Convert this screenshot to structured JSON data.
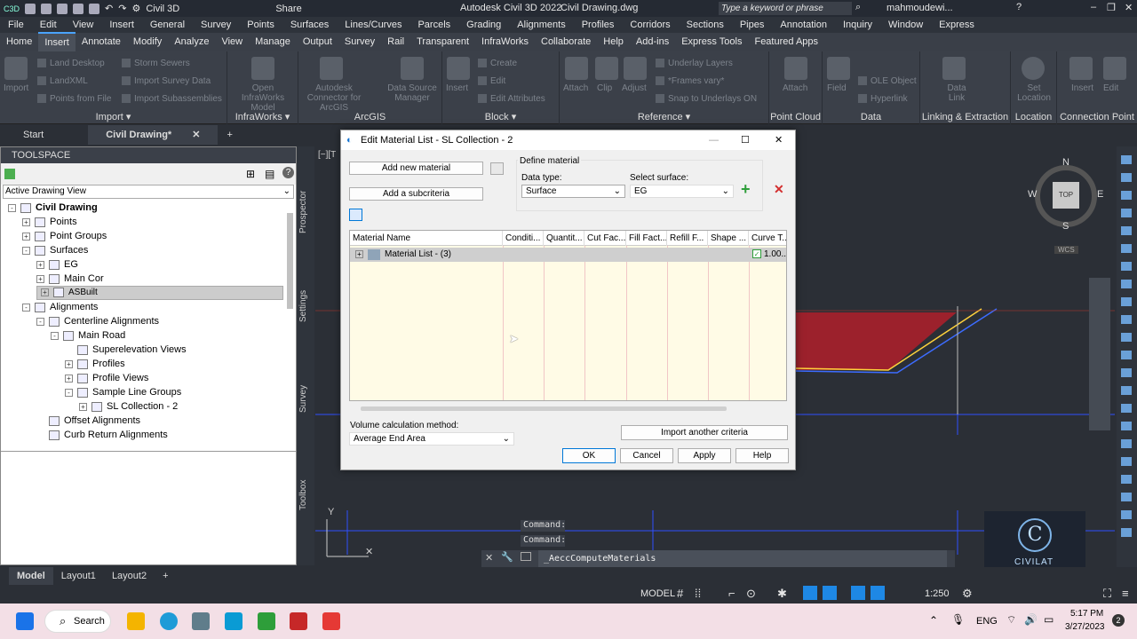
{
  "titlebar": {
    "workspace": "Civil 3D",
    "share": "Share",
    "app_title": "Autodesk Civil 3D 2022",
    "file_name": "Civil Drawing.dwg",
    "search_placeholder": "Type a keyword or phrase",
    "user": "mahmoudewi..."
  },
  "menu": [
    "File",
    "Edit",
    "View",
    "Insert",
    "General",
    "Survey",
    "Points",
    "Surfaces",
    "Lines/Curves",
    "Parcels",
    "Grading",
    "Alignments",
    "Profiles",
    "Corridors",
    "Sections",
    "Pipes",
    "Annotation",
    "Inquiry",
    "Window",
    "Express"
  ],
  "ribbon_tabs": [
    "Home",
    "Insert",
    "Annotate",
    "Modify",
    "Analyze",
    "View",
    "Manage",
    "Output",
    "Survey",
    "Rail",
    "Transparent",
    "InfraWorks",
    "Collaborate",
    "Help",
    "Add-ins",
    "Express Tools",
    "Featured Apps"
  ],
  "ribbon_active": "Insert",
  "ribbon": {
    "import": {
      "title": "Import",
      "big": "Import",
      "items": [
        "Land Desktop",
        "LandXML",
        "Points from File",
        "Storm Sewers",
        "Import Survey Data",
        "Import Subassemblies"
      ]
    },
    "infraworks": {
      "title": "InfraWorks",
      "big": "Open InfraWorks Model"
    },
    "arcgis": {
      "title": "ArcGIS",
      "big1": "Autodesk Connector for ArcGIS",
      "big2": "Data Source Manager"
    },
    "block": {
      "title": "Block",
      "big": "Insert",
      "items": [
        "Create",
        "Edit",
        "Edit Attributes"
      ]
    },
    "reference": {
      "title": "Reference",
      "big": [
        "Attach",
        "Clip",
        "Adjust"
      ],
      "items": [
        "Underlay Layers",
        "*Frames vary*",
        "Snap to Underlays ON"
      ]
    },
    "pointcloud": {
      "title": "Point Cloud",
      "big": "Attach"
    },
    "data": {
      "title": "Data",
      "big": "Field",
      "items": [
        "OLE Object",
        "Hyperlink"
      ]
    },
    "linking": {
      "title": "Linking & Extraction",
      "big": "Data Link"
    },
    "location": {
      "title": "Location",
      "big": "Set Location"
    },
    "connection": {
      "title": "Connection Point",
      "big": [
        "Insert",
        "Edit"
      ]
    }
  },
  "doc_tabs": [
    "Start",
    "Civil Drawing*"
  ],
  "toolspace": {
    "title": "TOOLSPACE",
    "view": "Active Drawing View",
    "tree": [
      {
        "label": "Civil Drawing",
        "indent": 0,
        "box": "-",
        "bold": true
      },
      {
        "label": "Points",
        "indent": 1,
        "box": "+"
      },
      {
        "label": "Point Groups",
        "indent": 1,
        "box": "+"
      },
      {
        "label": "Surfaces",
        "indent": 1,
        "box": "-"
      },
      {
        "label": "EG",
        "indent": 2,
        "box": "+"
      },
      {
        "label": "Main Cor",
        "indent": 2,
        "box": "+"
      },
      {
        "label": "ASBuilt",
        "indent": 2,
        "box": "+",
        "selected": true
      },
      {
        "label": "Alignments",
        "indent": 1,
        "box": "-"
      },
      {
        "label": "Centerline Alignments",
        "indent": 2,
        "box": "-"
      },
      {
        "label": "Main Road",
        "indent": 3,
        "box": "-"
      },
      {
        "label": "Superelevation Views",
        "indent": 4,
        "box": ""
      },
      {
        "label": "Profiles",
        "indent": 4,
        "box": "+"
      },
      {
        "label": "Profile Views",
        "indent": 4,
        "box": "+"
      },
      {
        "label": "Sample Line Groups",
        "indent": 4,
        "box": "-"
      },
      {
        "label": "SL Collection - 2",
        "indent": 5,
        "box": "+"
      },
      {
        "label": "Offset Alignments",
        "indent": 2,
        "box": ""
      },
      {
        "label": "Curb Return Alignments",
        "indent": 2,
        "box": ""
      }
    ],
    "side_tabs": [
      "Prospector",
      "Settings",
      "Survey",
      "Toolbox"
    ]
  },
  "viewport": {
    "label": "[−][T",
    "compass": {
      "n": "N",
      "s": "S",
      "e": "E",
      "w": "W",
      "top": "TOP",
      "wcs": "WCS"
    }
  },
  "dialog": {
    "title": "Edit Material List - SL Collection - 2",
    "add_material": "Add new material",
    "add_subcriteria": "Add a subcriteria",
    "define_material": "Define material",
    "data_type_label": "Data type:",
    "data_type_value": "Surface",
    "select_surface_label": "Select surface:",
    "select_surface_value": "EG",
    "columns": [
      "Material Name",
      "Conditi...",
      "Quantit...",
      "Cut Fac...",
      "Fill Fact...",
      "Refill F...",
      "Shape ...",
      "Curve T..."
    ],
    "row": {
      "name": "Material List - (3)",
      "curve": "1.00..."
    },
    "volume_label": "Volume calculation method:",
    "volume_value": "Average End Area",
    "import_criteria": "Import another criteria",
    "ok": "OK",
    "cancel": "Cancel",
    "apply": "Apply",
    "help": "Help"
  },
  "command": {
    "line1": "Command:",
    "line2": "Command:",
    "input": "_AeccComputeMaterials"
  },
  "layouts": [
    "Model",
    "Layout1",
    "Layout2"
  ],
  "status": {
    "model": "MODEL",
    "scale": "1:250"
  },
  "taskbar": {
    "search": "Search",
    "lang": "ENG",
    "time": "5:17 PM",
    "date": "3/27/2023",
    "notif": "2"
  },
  "watermark": {
    "brand": "CIVILAT"
  }
}
